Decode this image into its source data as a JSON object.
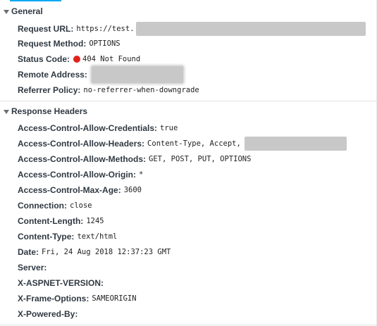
{
  "general": {
    "title": "General",
    "rows": [
      {
        "key": "Request URL:",
        "value": "https://test."
      },
      {
        "key": "Request Method:",
        "value": "OPTIONS"
      },
      {
        "key": "Status Code:",
        "value": "404 Not Found"
      },
      {
        "key": "Remote Address:",
        "value": ""
      },
      {
        "key": "Referrer Policy:",
        "value": "no-referrer-when-downgrade"
      }
    ]
  },
  "response_headers": {
    "title": "Response Headers",
    "rows": [
      {
        "key": "Access-Control-Allow-Credentials:",
        "value": "true"
      },
      {
        "key": "Access-Control-Allow-Headers:",
        "value": "Content-Type, Accept,"
      },
      {
        "key": "Access-Control-Allow-Methods:",
        "value": "GET, POST, PUT, OPTIONS"
      },
      {
        "key": "Access-Control-Allow-Origin:",
        "value": "*"
      },
      {
        "key": "Access-Control-Max-Age:",
        "value": "3600"
      },
      {
        "key": "Connection:",
        "value": "close"
      },
      {
        "key": "Content-Length:",
        "value": "1245"
      },
      {
        "key": "Content-Type:",
        "value": "text/html"
      },
      {
        "key": "Date:",
        "value": "Fri, 24 Aug 2018 12:37:23 GMT"
      },
      {
        "key": "Server:",
        "value": ""
      },
      {
        "key": "X-ASPNET-VERSION:",
        "value": ""
      },
      {
        "key": "X-Frame-Options:",
        "value": "SAMEORIGIN"
      },
      {
        "key": "X-Powered-By:",
        "value": ""
      }
    ]
  },
  "colors": {
    "status_dot": "#e0221c",
    "tab_indicator": "#03a9f4"
  }
}
